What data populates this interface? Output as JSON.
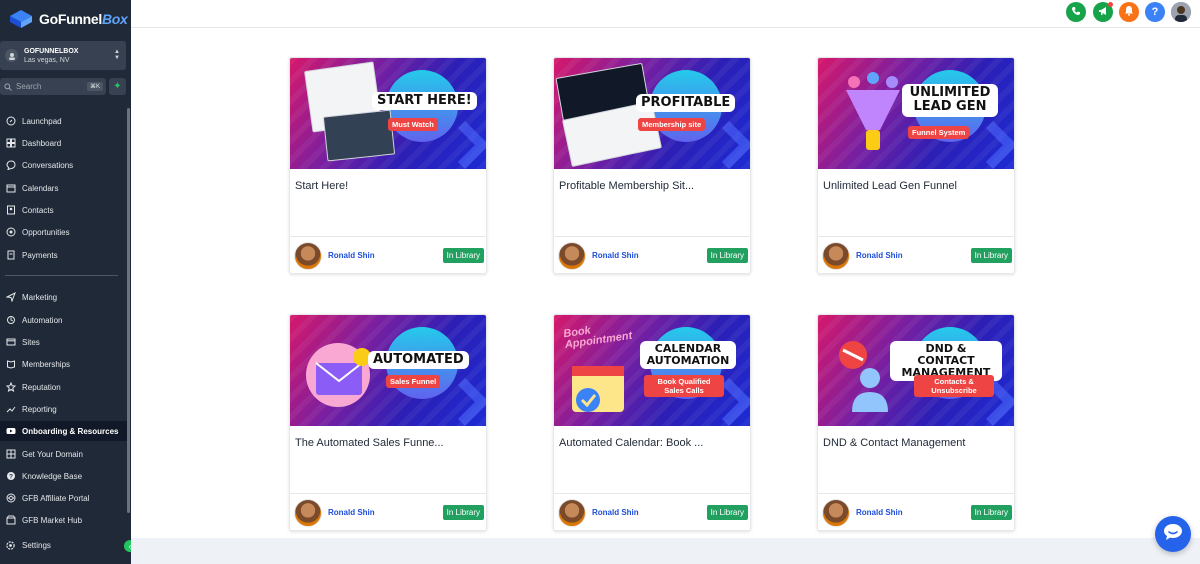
{
  "brand": {
    "logo_text_a": "GoFunnel",
    "logo_text_b": "Box"
  },
  "account": {
    "name": "GOFUNNELBOX",
    "location": "Las vegas, NV"
  },
  "search": {
    "placeholder": "Search",
    "shortcut": "⌘K"
  },
  "sidebar": {
    "items": [
      {
        "label": "Launchpad",
        "icon": "rocket-icon"
      },
      {
        "label": "Dashboard",
        "icon": "grid-icon"
      },
      {
        "label": "Conversations",
        "icon": "chat-icon"
      },
      {
        "label": "Calendars",
        "icon": "calendar-icon"
      },
      {
        "label": "Contacts",
        "icon": "contacts-icon"
      },
      {
        "label": "Opportunities",
        "icon": "funnel-icon"
      },
      {
        "label": "Payments",
        "icon": "payments-icon"
      },
      {
        "label": "Marketing",
        "icon": "send-icon"
      },
      {
        "label": "Automation",
        "icon": "automation-icon"
      },
      {
        "label": "Sites",
        "icon": "globe-icon"
      },
      {
        "label": "Memberships",
        "icon": "membership-icon"
      },
      {
        "label": "Reputation",
        "icon": "star-icon"
      },
      {
        "label": "Reporting",
        "icon": "chart-icon"
      },
      {
        "label": "Onboarding & Resources",
        "icon": "youtube-icon",
        "active": true
      },
      {
        "label": "Get Your Domain",
        "icon": "domain-icon"
      },
      {
        "label": "Knowledge Base",
        "icon": "help-icon"
      },
      {
        "label": "GFB Affiliate Portal",
        "icon": "handshake-icon"
      },
      {
        "label": "GFB Market Hub",
        "icon": "market-icon"
      }
    ],
    "settings_label": "Settings"
  },
  "topbar": {
    "phone_icon": "phone-icon",
    "megaphone_icon": "megaphone-icon",
    "bell_icon": "bell-icon",
    "help_label": "?",
    "colors": {
      "phone": "#16a34a",
      "megaphone": "#16a34a",
      "bell": "#f97316",
      "help": "#3b82f6"
    }
  },
  "cards": [
    {
      "title": "Start Here!",
      "headline": "START HERE!",
      "sub": "Must Watch",
      "author": "Ronald Shin",
      "badge": "In Library"
    },
    {
      "title": "Profitable Membership Sit...",
      "headline": "PROFITABLE",
      "sub": "Membership site",
      "author": "Ronald Shin",
      "badge": "In Library"
    },
    {
      "title": "Unlimited Lead Gen Funnel",
      "headline": "UNLIMITED LEAD GEN",
      "sub": "Funnel System",
      "author": "Ronald Shin",
      "badge": "In Library"
    },
    {
      "title": "The Automated Sales Funne...",
      "headline": "AUTOMATED",
      "sub": "Sales Funnel",
      "author": "Ronald Shin",
      "badge": "In Library"
    },
    {
      "title": "Automated Calendar: Book ...",
      "headline": "CALENDAR AUTOMATION",
      "sub": "Book Qualified Sales Calls",
      "author": "Ronald Shin",
      "badge": "In Library",
      "art_text": "Book Appointment"
    },
    {
      "title": "DND & Contact Management",
      "headline": "DND & CONTACT MANAGEMENT",
      "sub": "Contacts & Unsubscribe",
      "author": "Ronald Shin",
      "badge": "In Library"
    }
  ]
}
